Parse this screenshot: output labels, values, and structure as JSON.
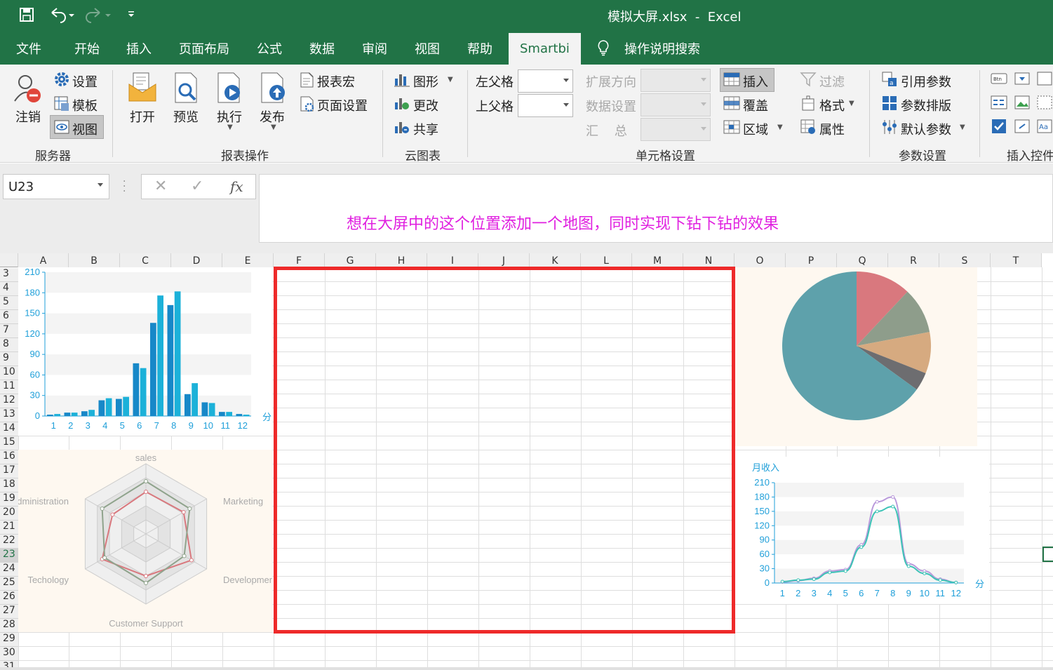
{
  "title": {
    "text": "模拟大屏.xlsx  -  Excel"
  },
  "tabs": [
    "文件",
    "开始",
    "插入",
    "页面布局",
    "公式",
    "数据",
    "审阅",
    "视图",
    "帮助",
    "Smartbi",
    "操作说明搜索"
  ],
  "ribbon": {
    "server": {
      "settings": "设置",
      "logout": "注销",
      "template": "模板",
      "view": "视图",
      "group": "服务器"
    },
    "report": {
      "open": "打开",
      "preview": "预览",
      "execute": "执行",
      "publish": "发布",
      "macro": "报表宏",
      "page_setup": "页面设置",
      "group": "报表操作"
    },
    "cloud": {
      "chart": "图形",
      "change": "更改",
      "share": "共享",
      "group": "云图表"
    },
    "cell": {
      "left_parent": "左父格",
      "top_parent": "上父格",
      "expand": "扩展方向",
      "data_setting": "数据设置",
      "summary": "汇    总",
      "insert": "插入",
      "cover": "覆盖",
      "area": "区域",
      "filter": "过滤",
      "format": "格式",
      "attr": "属性",
      "group": "单元格设置"
    },
    "param": {
      "ref": "引用参数",
      "layout": "参数排版",
      "default": "默认参数",
      "group": "参数设置"
    },
    "control": {
      "group": "插入控件"
    }
  },
  "formula_bar": {
    "name_box": "U23",
    "fx": "fx",
    "content": "想在大屏中的这个位置添加一个地图，同时实现下钻下钻的效果"
  },
  "columns": [
    "A",
    "B",
    "C",
    "D",
    "E",
    "F",
    "G",
    "H",
    "I",
    "J",
    "K",
    "L",
    "M",
    "N",
    "O",
    "P",
    "Q",
    "R",
    "S",
    "T"
  ],
  "rows": [
    "3",
    "4",
    "5",
    "6",
    "7",
    "8",
    "9",
    "10",
    "11",
    "12",
    "13",
    "14",
    "15",
    "16",
    "17",
    "18",
    "19",
    "20",
    "21",
    "22",
    "23",
    "24",
    "25",
    "26",
    "27",
    "28",
    "29",
    "30",
    "31"
  ],
  "chart_data": [
    {
      "type": "bar",
      "categories": [
        "1",
        "2",
        "3",
        "4",
        "5",
        "6",
        "7",
        "8",
        "9",
        "10",
        "11",
        "12"
      ],
      "series": [
        {
          "values": [
            2.6,
            5.9,
            9.0,
            26.4,
            28.7,
            70.7,
            175.6,
            182.2,
            48.7,
            18.8,
            6.0,
            2.3
          ]
        },
        {
          "values": [
            2.6,
            5.9,
            9.0,
            26.4,
            28.7,
            70.7,
            175.6,
            182.2,
            48.7,
            18.8,
            6.0,
            2.3
          ]
        }
      ],
      "raw": [
        2,
        3,
        5,
        5,
        7,
        9,
        23,
        26,
        25,
        28,
        77,
        70,
        136,
        176,
        162,
        182,
        32,
        48,
        20,
        19,
        6,
        6,
        3,
        2
      ],
      "xlabel": "分",
      "yticks": [
        0,
        30,
        60,
        90,
        120,
        150,
        180,
        210
      ],
      "ylim": [
        0,
        210
      ],
      "color": "#1f9fd9"
    },
    {
      "type": "radar",
      "indicators": [
        "sales",
        "Marketing",
        "Development",
        "Customer Support",
        "Techology",
        "Administration"
      ],
      "series": [
        {
          "values": [
            0.6,
            0.62,
            0.75,
            0.6,
            0.72,
            0.55
          ],
          "color": "#d9787e"
        },
        {
          "values": [
            0.75,
            0.72,
            0.63,
            0.7,
            0.68,
            0.72
          ],
          "color": "#8fa38c"
        }
      ]
    },
    {
      "type": "pie",
      "values": [
        12,
        10,
        9,
        4,
        65
      ],
      "colors": [
        "#d9787e",
        "#8e9d8b",
        "#d6aa80",
        "#6d6d70",
        "#5ea1ab"
      ]
    },
    {
      "type": "line",
      "ylabel": "月收入",
      "xlabel": "分",
      "categories": [
        "1",
        "2",
        "3",
        "4",
        "5",
        "6",
        "7",
        "8",
        "9",
        "10",
        "11",
        "12"
      ],
      "yticks": [
        0,
        30,
        60,
        90,
        120,
        150,
        180,
        210
      ],
      "ylim": [
        0,
        210
      ],
      "series": [
        {
          "values": [
            2,
            5,
            10,
            25,
            28,
            80,
            170,
            180,
            40,
            25,
            8,
            1
          ],
          "color": "#b99adb"
        },
        {
          "values": [
            3,
            6,
            8,
            22,
            25,
            75,
            150,
            160,
            35,
            20,
            6,
            1
          ],
          "color": "#3cc3b6"
        }
      ]
    }
  ]
}
